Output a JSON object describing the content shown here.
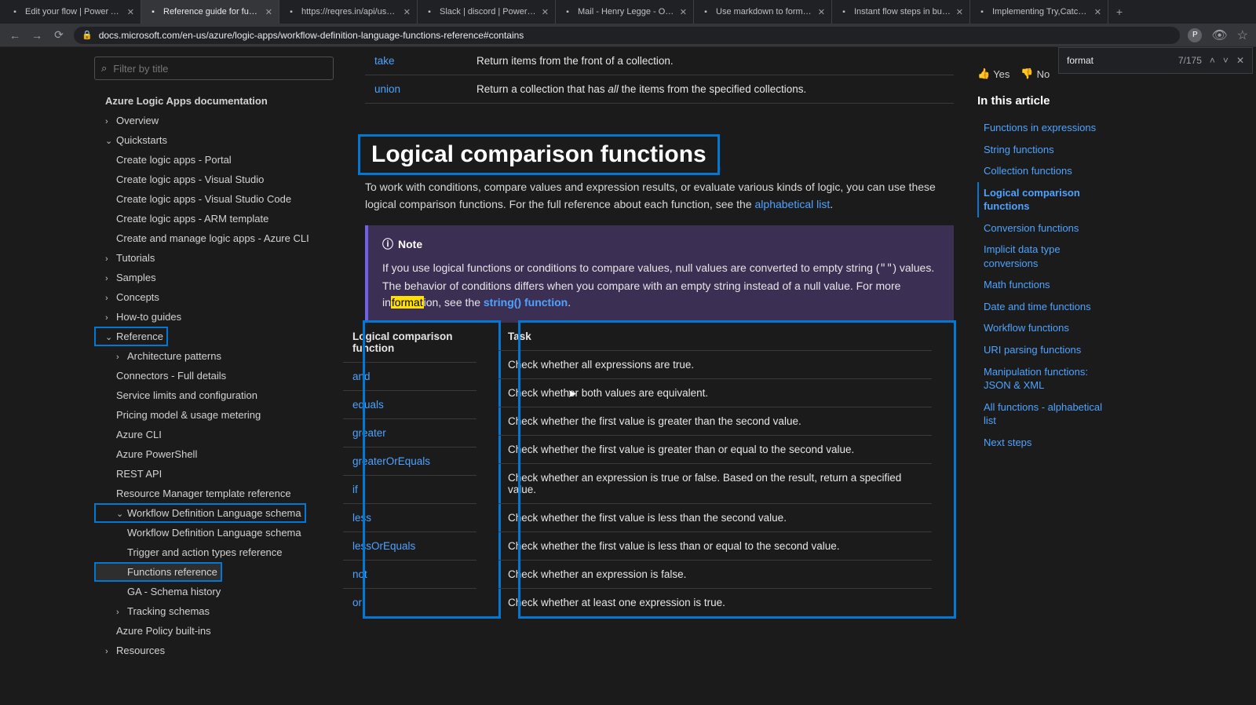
{
  "tabs": [
    {
      "title": "Edit your flow | Power Auto"
    },
    {
      "title": "Reference guide for functio"
    },
    {
      "title": "https://reqres.in/api/users?"
    },
    {
      "title": "Slack | discord | Power Aut"
    },
    {
      "title": "Mail - Henry Legge - Outlo"
    },
    {
      "title": "Use markdown to format Po"
    },
    {
      "title": "Instant flow steps in busine"
    },
    {
      "title": "Implementing Try,Catch an"
    }
  ],
  "url": "docs.microsoft.com/en-us/azure/logic-apps/workflow-definition-language-functions-reference#contains",
  "findbar": {
    "query": "format",
    "count": "7/175"
  },
  "filter_placeholder": "Filter by title",
  "nav": {
    "root": "Azure Logic Apps documentation",
    "overview": "Overview",
    "quickstarts": "Quickstarts",
    "qs": [
      "Create logic apps - Portal",
      "Create logic apps - Visual Studio",
      "Create logic apps - Visual Studio Code",
      "Create logic apps - ARM template",
      "Create and manage logic apps - Azure CLI"
    ],
    "tutorials": "Tutorials",
    "samples": "Samples",
    "concepts": "Concepts",
    "howto": "How-to guides",
    "reference": "Reference",
    "ref": [
      "Architecture patterns",
      "Connectors - Full details",
      "Service limits and configuration",
      "Pricing model & usage metering",
      "Azure CLI",
      "Azure PowerShell",
      "REST API",
      "Resource Manager template reference"
    ],
    "wdls": "Workflow Definition Language schema",
    "wdls_items": [
      "Workflow Definition Language schema",
      "Trigger and action types reference",
      "Functions reference",
      "GA - Schema history"
    ],
    "tracking": "Tracking schemas",
    "policy": "Azure Policy built-ins",
    "resources": "Resources"
  },
  "prior_rows": [
    {
      "fn": "take",
      "desc": "Return items from the front of a collection."
    },
    {
      "fn": "union",
      "desc_pre": "Return a collection that has ",
      "em": "all",
      "desc_post": " the items from the specified collections."
    }
  ],
  "section_title": "Logical comparison functions",
  "intro_pre": "To work with conditions, compare values and expression results, or evaluate various kinds of logic, you can use these logical comparison functions. For the full reference about each function, see the ",
  "intro_link": "alphabetical list",
  "intro_post": ".",
  "note": {
    "label": "Note",
    "body_pre": "If you use logical functions or conditions to compare values, null values are converted to empty string (",
    "code1": "\"\"",
    "body_mid": ") values. The behavior of conditions differs when you compare with an empty string instead of a null value. For more in",
    "mark": "format",
    "body_mid2": "ion, see the ",
    "link": "string() function",
    "body_post": "."
  },
  "headers": {
    "fn": "Logical comparison function",
    "task": "Task"
  },
  "rows": [
    {
      "fn": "and",
      "task": "Check whether all expressions are true."
    },
    {
      "fn": "equals",
      "task": "Check whether both values are equivalent."
    },
    {
      "fn": "greater",
      "task": "Check whether the first value is greater than the second value."
    },
    {
      "fn": "greaterOrEquals",
      "task": "Check whether the first value is greater than or equal to the second value."
    },
    {
      "fn": "if",
      "task": "Check whether an expression is true or false. Based on the result, return a specified value."
    },
    {
      "fn": "less",
      "task": "Check whether the first value is less than the second value."
    },
    {
      "fn": "lessOrEquals",
      "task": "Check whether the first value is less than or equal to the second value."
    },
    {
      "fn": "not",
      "task": "Check whether an expression is false."
    },
    {
      "fn": "or",
      "task": "Check whether at least one expression is true."
    }
  ],
  "feedback": {
    "yes": "Yes",
    "no": "No"
  },
  "toc": {
    "head": "In this article",
    "items": [
      "Functions in expressions",
      "String functions",
      "Collection functions",
      "Logical comparison functions",
      "Conversion functions",
      "Implicit data type conversions",
      "Math functions",
      "Date and time functions",
      "Workflow functions",
      "URI parsing functions",
      "Manipulation functions: JSON & XML",
      "All functions - alphabetical list",
      "Next steps"
    ],
    "active_index": 3
  }
}
